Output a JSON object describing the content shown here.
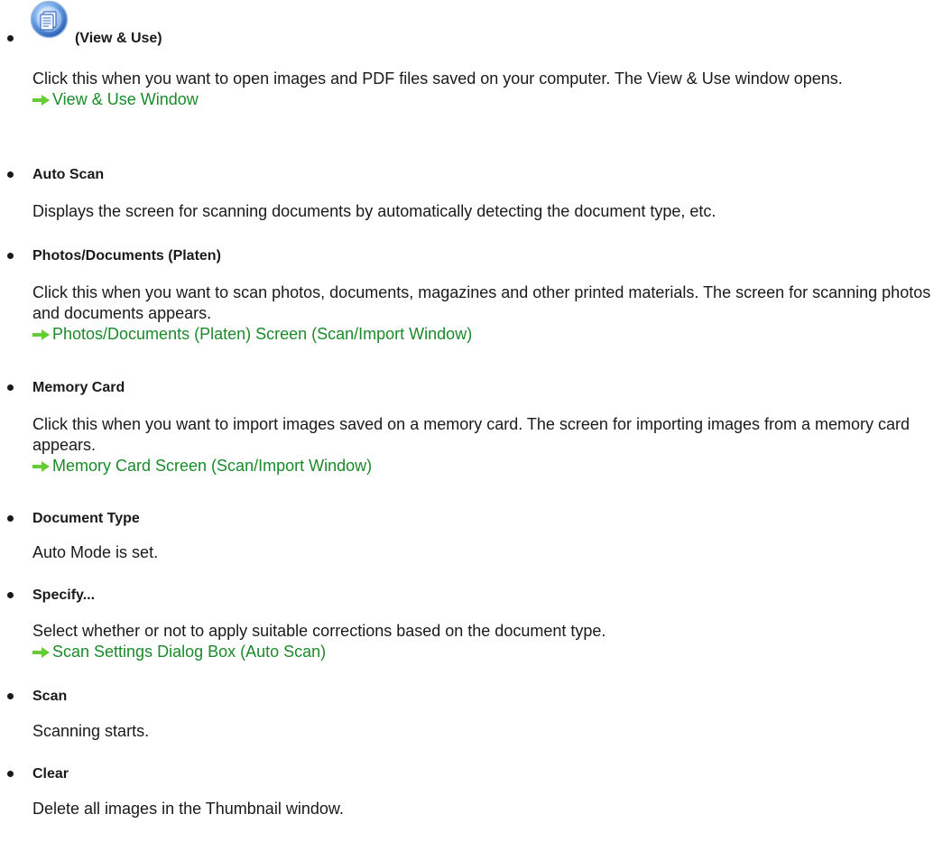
{
  "entries": [
    {
      "term": "(View & Use)",
      "icon": "view-and-use-icon",
      "lines": [
        "Click this when you want to open images and PDF files saved on your computer. The View & Use window opens."
      ],
      "link": "View & Use Window"
    },
    {
      "term": "Auto Scan",
      "lines": [
        "Displays the screen for scanning documents by automatically detecting the document type, etc."
      ]
    },
    {
      "term": "Photos/Documents (Platen)",
      "lines": [
        "Click this when you want to scan photos, documents, magazines and other printed materials. The screen for scanning photos and documents appears."
      ],
      "link": "Photos/Documents (Platen) Screen (Scan/Import Window)"
    },
    {
      "term": "Memory Card",
      "lines": [
        "Click this when you want to import images saved on a memory card. The screen for importing images from a memory card appears."
      ],
      "link": "Memory Card Screen (Scan/Import Window)"
    },
    {
      "term": "Document Type",
      "lines": [
        "Auto Mode is set."
      ]
    },
    {
      "term": "Specify...",
      "lines": [
        "Select whether or not to apply suitable corrections based on the document type."
      ],
      "link": "Scan Settings Dialog Box (Auto Scan)"
    },
    {
      "term": "Scan",
      "lines": [
        "Scanning starts."
      ]
    },
    {
      "term": "Clear",
      "lines": [
        "Delete all images in the Thumbnail window."
      ]
    }
  ],
  "colors": {
    "link": "#1a8a2a",
    "arrow": "#66cc33",
    "text": "#1a1a1a"
  }
}
